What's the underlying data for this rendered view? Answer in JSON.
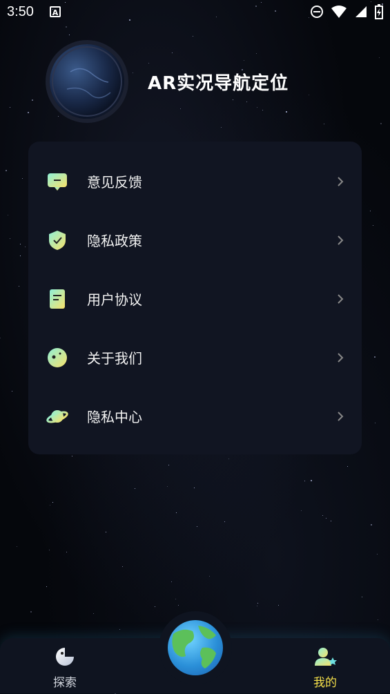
{
  "status_bar": {
    "time": "3:50",
    "icons": [
      "notification-a-icon",
      "do-not-disturb-icon",
      "wifi-icon",
      "signal-icon",
      "battery-charging-icon"
    ]
  },
  "header": {
    "app_title": "AR实况导航定位",
    "avatar": "earth-avatar"
  },
  "menu": {
    "items": [
      {
        "label": "意见反馈",
        "icon": "feedback-icon"
      },
      {
        "label": "隐私政策",
        "icon": "shield-check-icon"
      },
      {
        "label": "用户协议",
        "icon": "document-icon"
      },
      {
        "label": "关于我们",
        "icon": "info-planet-icon"
      },
      {
        "label": "隐私中心",
        "icon": "saturn-icon"
      }
    ]
  },
  "bottom_nav": {
    "tabs": [
      {
        "label": "探索",
        "icon": "pacman-explore-icon",
        "active": false
      },
      {
        "label": "我的",
        "icon": "user-star-icon",
        "active": true
      }
    ],
    "center": "globe-icon",
    "active_color": "#f5e04a"
  }
}
